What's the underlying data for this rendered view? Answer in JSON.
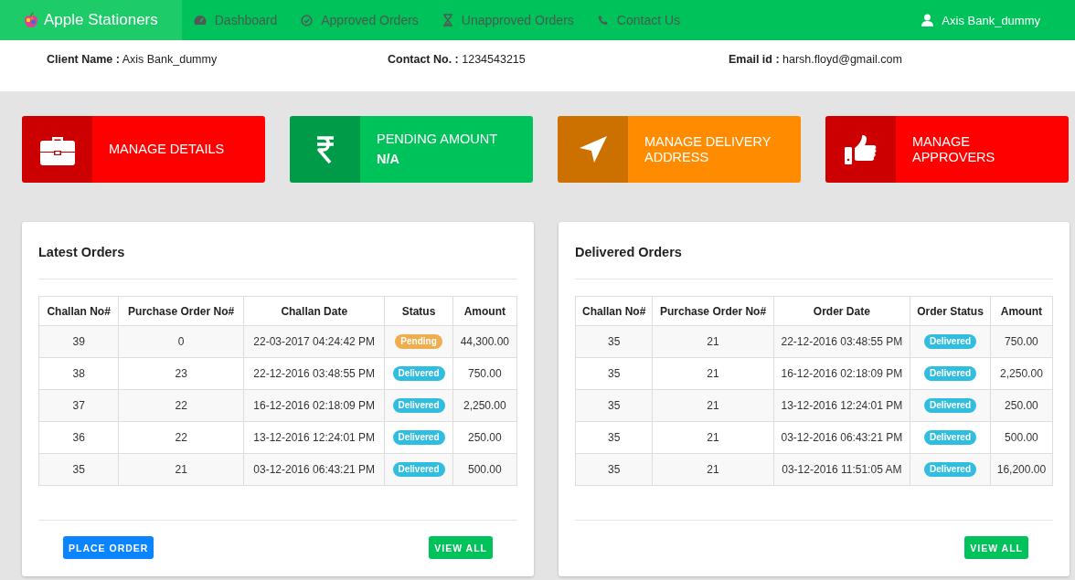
{
  "brand": {
    "name": "Apple Stationers"
  },
  "nav": [
    {
      "label": "Dashboard"
    },
    {
      "label": "Approved Orders"
    },
    {
      "label": "Unapproved Orders"
    },
    {
      "label": "Contact Us"
    }
  ],
  "user": {
    "name": "Axis Bank_dummy"
  },
  "client": [
    {
      "label": "Client Name :",
      "value": "Axis Bank_dummy"
    },
    {
      "label": "Contact No. :",
      "value": "1234543215"
    },
    {
      "label": "Email id :",
      "value": "harsh.floyd@gmail.com"
    }
  ],
  "tiles": [
    {
      "title": "MANAGE DETAILS",
      "color": "#ff0000"
    },
    {
      "title": "PENDING AMOUNT",
      "value": "N/A",
      "color": "#00c25a"
    },
    {
      "title": "MANAGE DELIVERY ADDRESS",
      "color": "#ff8c00"
    },
    {
      "title": "MANAGE APPROVERS",
      "color": "#ff0000"
    }
  ],
  "panels": [
    {
      "title": "Latest Orders",
      "columns": [
        "Challan No#",
        "Purchase Order No#",
        "Challan Date",
        "Status",
        "Amount"
      ],
      "rows": [
        [
          "39",
          "0",
          "22-03-2017 04:24:42 PM",
          {
            "label": "Pending",
            "color": "#f0ad4e"
          },
          "44,300.00"
        ],
        [
          "38",
          "23",
          "22-12-2016 03:48:55 PM",
          {
            "label": "Delivered",
            "color": "#31bde0"
          },
          "750.00"
        ],
        [
          "37",
          "22",
          "16-12-2016 02:18:09 PM",
          {
            "label": "Delivered",
            "color": "#31bde0"
          },
          "2,250.00"
        ],
        [
          "36",
          "22",
          "13-12-2016 12:24:01 PM",
          {
            "label": "Delivered",
            "color": "#31bde0"
          },
          "250.00"
        ],
        [
          "35",
          "21",
          "03-12-2016 06:43:21 PM",
          {
            "label": "Delivered",
            "color": "#31bde0"
          },
          "500.00"
        ]
      ],
      "buttons": [
        {
          "label": "PLACE ORDER",
          "color": "#0a84ff"
        },
        {
          "label": "VIEW ALL",
          "color": "#00c25a"
        }
      ]
    },
    {
      "title": "Delivered Orders",
      "columns": [
        "Challan No#",
        "Purchase Order No#",
        "Order Date",
        "Order Status",
        "Amount"
      ],
      "rows": [
        [
          "35",
          "21",
          "22-12-2016 03:48:55 PM",
          {
            "label": "Delivered",
            "color": "#31bde0"
          },
          "750.00"
        ],
        [
          "35",
          "21",
          "16-12-2016 02:18:09 PM",
          {
            "label": "Delivered",
            "color": "#31bde0"
          },
          "2,250.00"
        ],
        [
          "35",
          "21",
          "13-12-2016 12:24:01 PM",
          {
            "label": "Delivered",
            "color": "#31bde0"
          },
          "250.00"
        ],
        [
          "35",
          "21",
          "03-12-2016 06:43:21 PM",
          {
            "label": "Delivered",
            "color": "#31bde0"
          },
          "500.00"
        ],
        [
          "35",
          "21",
          "03-12-2016 11:51:05 AM",
          {
            "label": "Delivered",
            "color": "#31bde0"
          },
          "16,200.00"
        ]
      ],
      "buttons": [
        {
          "label": "VIEW ALL",
          "color": "#00c25a"
        }
      ]
    }
  ]
}
